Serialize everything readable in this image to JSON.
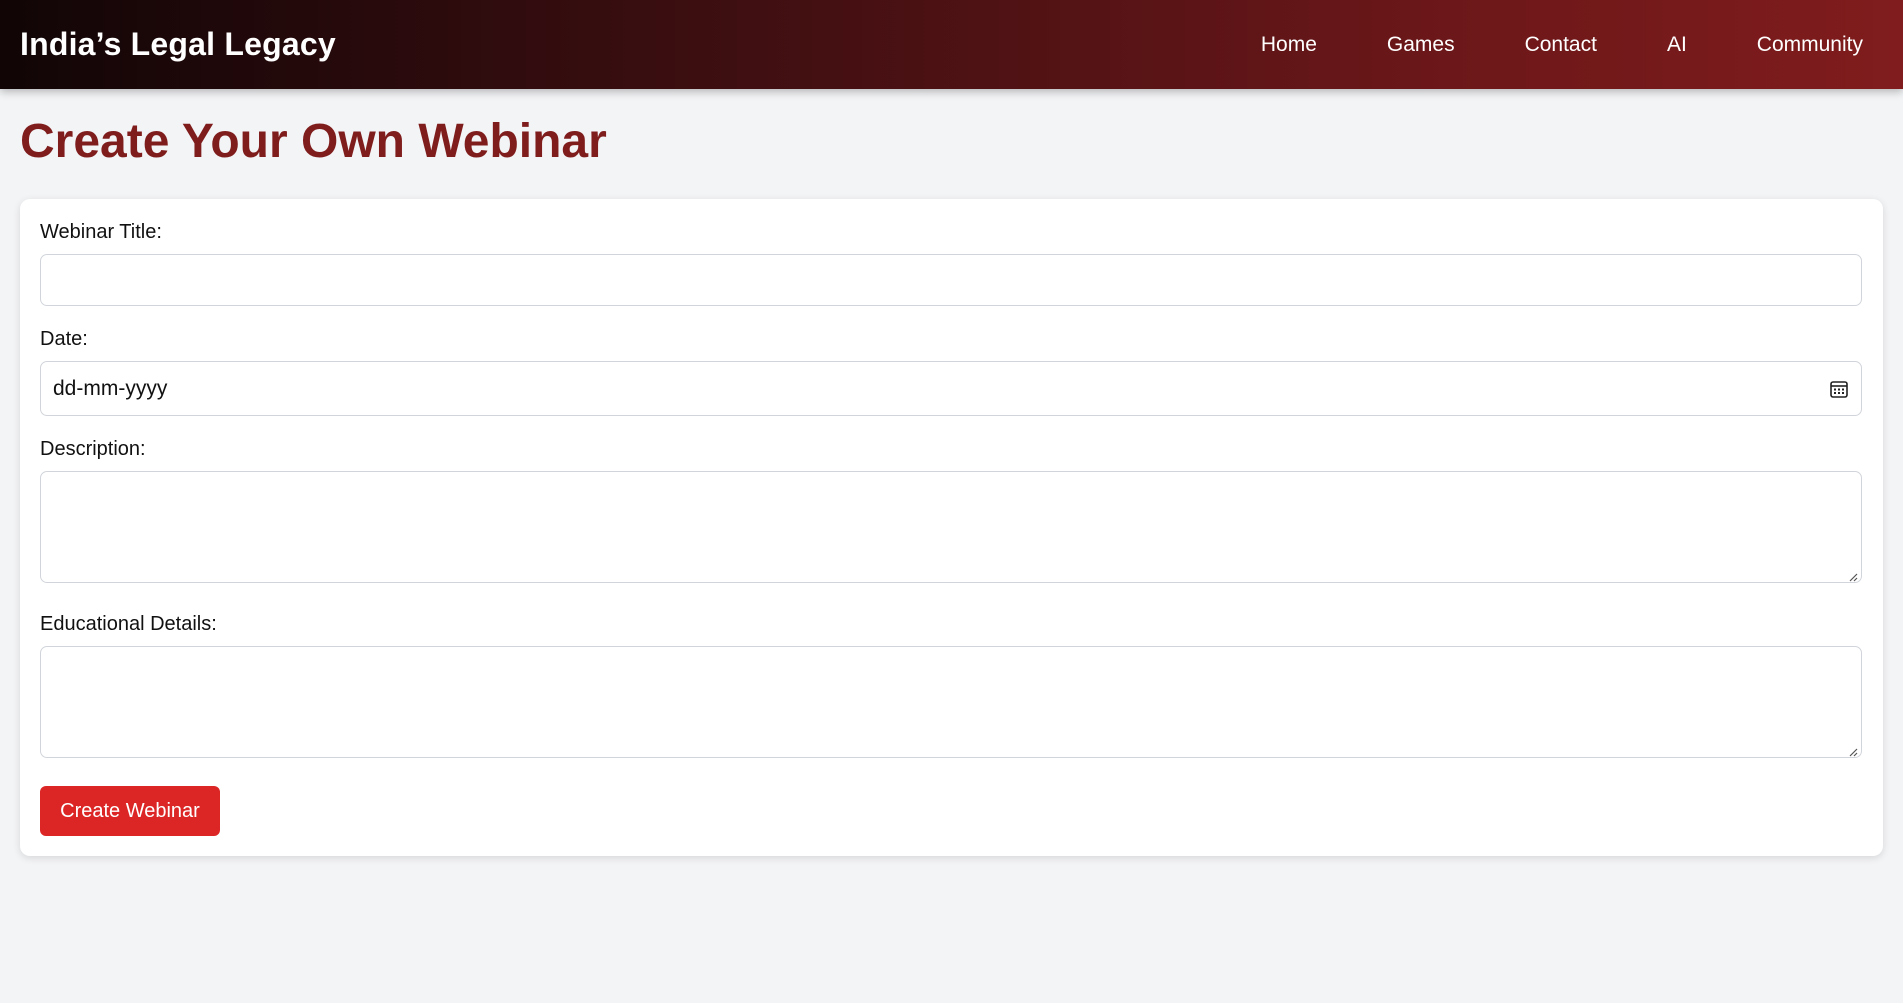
{
  "header": {
    "brand": "India’s Legal Legacy",
    "nav": [
      "Home",
      "Games",
      "Contact",
      "AI",
      "Community"
    ]
  },
  "page": {
    "title": "Create Your Own Webinar"
  },
  "form": {
    "title_label": "Webinar Title:",
    "title_value": "",
    "date_label": "Date:",
    "date_placeholder": "dd-mm-yyyy",
    "description_label": "Description:",
    "description_value": "",
    "educational_label": "Educational Details:",
    "educational_value": "",
    "submit_label": "Create Webinar"
  },
  "colors": {
    "header_gradient_start": "#110506",
    "header_gradient_end": "#801c1d",
    "title": "#7f1d1d",
    "button": "#dc2626",
    "background": "#f3f4f6"
  },
  "icons": {
    "date_picker": "calendar-icon",
    "textarea_resize": "resize-handle-icon"
  }
}
